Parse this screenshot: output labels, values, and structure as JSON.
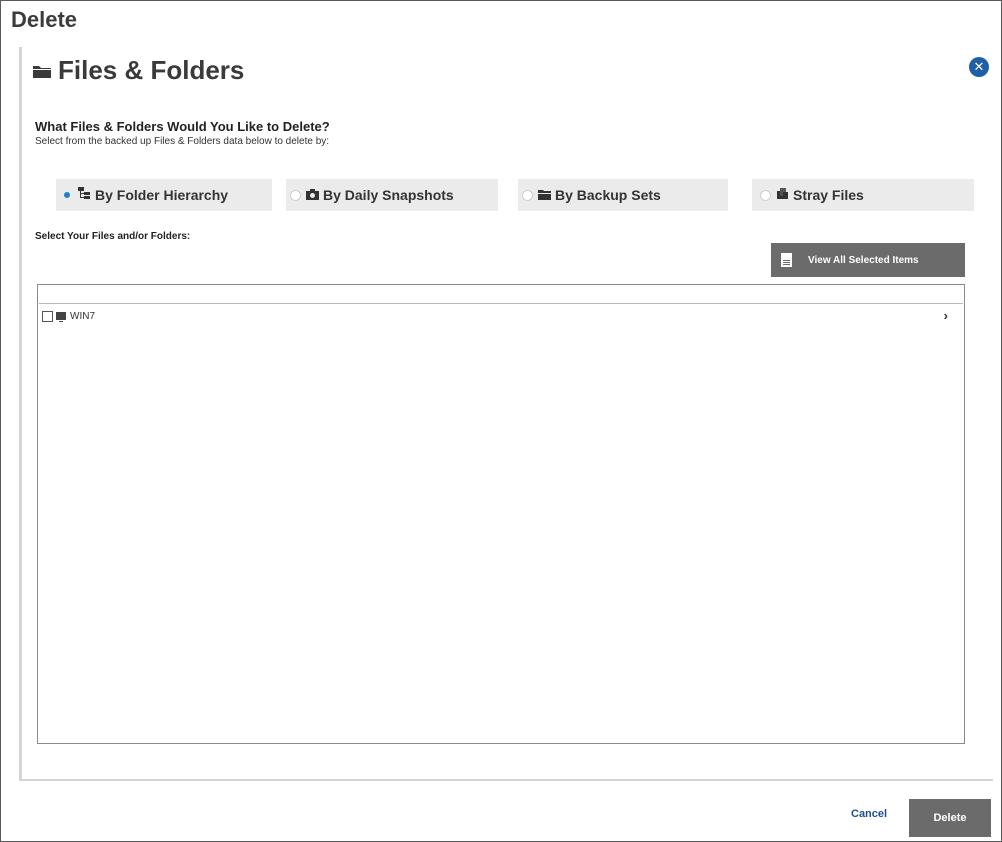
{
  "dialog": {
    "title": "Delete",
    "panel_title": "Files & Folders",
    "close_icon": "close-circle-icon"
  },
  "prompt": {
    "question": "What Files & Folders Would You Like to Delete?",
    "subtitle": "Select from the backed up Files & Folders data below to delete by:"
  },
  "modes": [
    {
      "label": "By Folder Hierarchy",
      "icon": "folder-hierarchy-icon",
      "selected": true
    },
    {
      "label": "By Daily Snapshots",
      "icon": "camera-icon",
      "selected": false
    },
    {
      "label": "By Backup Sets",
      "icon": "folder-icon",
      "selected": false
    },
    {
      "label": "Stray Files",
      "icon": "stray-files-icon",
      "selected": false
    }
  ],
  "selection": {
    "label": "Select Your Files and/or Folders:",
    "view_all_label": "View All Selected Items"
  },
  "tree": {
    "items": [
      {
        "label": "WIN7",
        "icon": "computer-icon",
        "checked": false
      }
    ]
  },
  "footer": {
    "cancel_label": "Cancel",
    "delete_label": "Delete"
  },
  "colors": {
    "accent": "#1f7ed0",
    "close_button": "#1f5fa8",
    "button_gray": "#6b6b6b",
    "cancel_link": "#1f4f8a"
  }
}
